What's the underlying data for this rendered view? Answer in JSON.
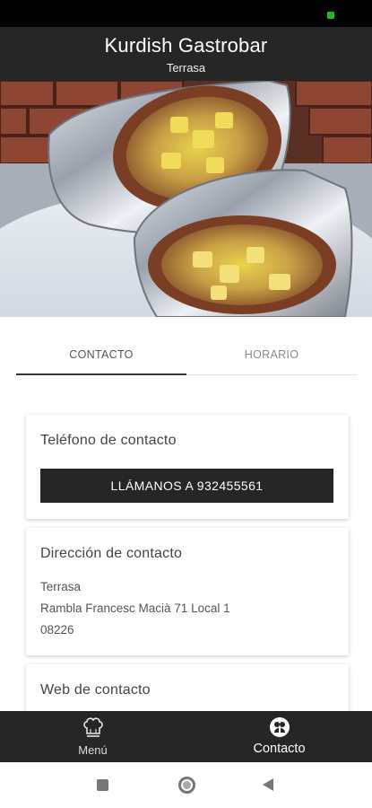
{
  "header": {
    "title": "Kurdish Gastrobar",
    "subtitle": "Terrasa"
  },
  "hero": {
    "image_icon": "burrito-photo"
  },
  "tabs": [
    {
      "label": "CONTACTO",
      "active": true
    },
    {
      "label": "HORARIO",
      "active": false
    }
  ],
  "contact": {
    "phone_title": "Teléfono de contacto",
    "call_button": "LLÁMANOS A 932455561",
    "address_title": "Dirección de contacto",
    "address_lines": [
      "Terrasa",
      "Rambla Francesc Macià 71 Local 1",
      "08226"
    ],
    "web_title": "Web de contacto"
  },
  "bottom_nav": [
    {
      "label": "Menú",
      "icon": "chef-hat-icon",
      "active": false
    },
    {
      "label": "Contacto",
      "icon": "contact-icon",
      "active": true
    }
  ],
  "colors": {
    "header_bg": "#262626",
    "status_indicator": "#1fb91f"
  }
}
